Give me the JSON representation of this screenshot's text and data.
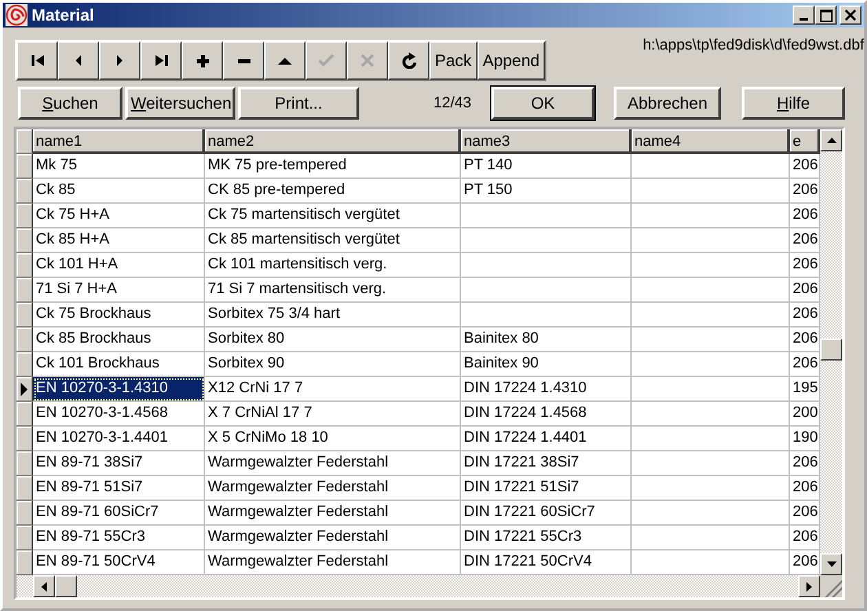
{
  "window": {
    "title": "Material"
  },
  "toolbar": [
    {
      "kind": "first",
      "disabled": false
    },
    {
      "kind": "prev",
      "disabled": false
    },
    {
      "kind": "next",
      "disabled": false
    },
    {
      "kind": "last",
      "disabled": false
    },
    {
      "kind": "add",
      "disabled": false
    },
    {
      "kind": "delete",
      "disabled": false
    },
    {
      "kind": "up",
      "disabled": false
    },
    {
      "kind": "confirm",
      "disabled": true
    },
    {
      "kind": "cancel",
      "disabled": true
    },
    {
      "kind": "refresh",
      "disabled": false
    },
    {
      "kind": "text",
      "label": "Pack",
      "disabled": false
    },
    {
      "kind": "text",
      "label": "Append",
      "disabled": false
    }
  ],
  "file_path": "h:\\apps\\tp\\fed9disk\\d\\fed9wst.dbf",
  "search_buttons": [
    {
      "label": "Suchen",
      "underline_first": true
    },
    {
      "label": "Weitersuchen",
      "underline_first": true
    },
    {
      "label": "Print...",
      "underline_first": false
    }
  ],
  "record_counter": "12/43",
  "dialog_buttons": [
    {
      "label": "OK",
      "default": true,
      "underline_first": false
    },
    {
      "label": "Abbrechen",
      "default": false,
      "underline_first": false
    },
    {
      "label": "Hilfe",
      "default": false,
      "underline_first": true
    }
  ],
  "table": {
    "columns": [
      "name1",
      "name2",
      "name3",
      "name4",
      "e"
    ],
    "rows": [
      {
        "selected": false,
        "cells": [
          "Mk 75",
          "MK 75 pre-tempered",
          "PT 140",
          "",
          "206"
        ]
      },
      {
        "selected": false,
        "cells": [
          "Ck 85",
          "CK 85 pre-tempered",
          "PT 150",
          "",
          "206"
        ]
      },
      {
        "selected": false,
        "cells": [
          "Ck 75 H+A",
          "Ck 75 martensitisch vergütet",
          "",
          "",
          "206"
        ]
      },
      {
        "selected": false,
        "cells": [
          "Ck 85 H+A",
          "Ck 85 martensitisch vergütet",
          "",
          "",
          "206"
        ]
      },
      {
        "selected": false,
        "cells": [
          "Ck 101 H+A",
          "Ck 101 martensitisch verg.",
          "",
          "",
          "206"
        ]
      },
      {
        "selected": false,
        "cells": [
          "71 Si 7 H+A",
          "71 Si 7 martensitisch verg.",
          "",
          "",
          "206"
        ]
      },
      {
        "selected": false,
        "cells": [
          "Ck 75 Brockhaus",
          "Sorbitex 75  3/4 hart",
          "",
          "",
          "206"
        ]
      },
      {
        "selected": false,
        "cells": [
          "Ck 85 Brockhaus",
          "Sorbitex 80",
          "Bainitex 80",
          "",
          "206"
        ]
      },
      {
        "selected": false,
        "cells": [
          "Ck 101 Brockhaus",
          "Sorbitex 90",
          "Bainitex 90",
          "",
          "206"
        ]
      },
      {
        "selected": true,
        "cells": [
          "EN 10270-3-1.4310",
          "X12 CrNi 17 7",
          "DIN 17224 1.4310",
          "",
          "195"
        ]
      },
      {
        "selected": false,
        "cells": [
          "EN 10270-3-1.4568",
          "X 7 CrNiAl 17 7",
          "DIN 17224 1.4568",
          "",
          "200"
        ]
      },
      {
        "selected": false,
        "cells": [
          "EN 10270-3-1.4401",
          "X 5 CrNiMo 18 10",
          "DIN 17224 1.4401",
          "",
          "190"
        ]
      },
      {
        "selected": false,
        "cells": [
          "EN 89-71 38Si7",
          "Warmgewalzter Federstahl",
          "DIN 17221 38Si7",
          "",
          "206"
        ]
      },
      {
        "selected": false,
        "cells": [
          "EN 89-71 51Si7",
          "Warmgewalzter Federstahl",
          "DIN 17221 51Si7",
          "",
          "206"
        ]
      },
      {
        "selected": false,
        "cells": [
          "EN 89-71 60SiCr7",
          "Warmgewalzter Federstahl",
          "DIN 17221 60SiCr7",
          "",
          "206"
        ]
      },
      {
        "selected": false,
        "cells": [
          "EN 89-71 55Cr3",
          "Warmgewalzter Federstahl",
          "DIN 17221 55Cr3",
          "",
          "206"
        ]
      },
      {
        "selected": false,
        "cells": [
          "EN 89-71 50CrV4",
          "Warmgewalzter Federstahl",
          "DIN 17221 50CrV4",
          "",
          "206"
        ]
      }
    ]
  }
}
